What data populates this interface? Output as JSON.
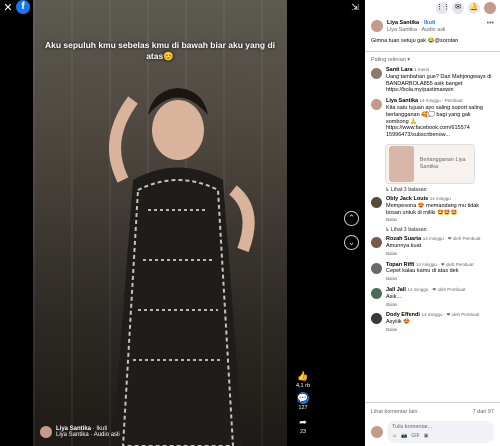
{
  "viewer": {
    "caption": "Aku sepuluh kmu sebelas kmu di bawah biar aku yang di atas😊",
    "overlay_name": "Liya Santika",
    "overlay_follow": "Ikuti",
    "overlay_audio": "Liya Santika · Audio asli",
    "watermark": "Liya Santika",
    "like_count": "4,1 rb",
    "comment_count": "127",
    "share_count": "23"
  },
  "panel": {
    "author": "Liya Santika",
    "follow": "Ikuti",
    "audio": "Liya Santika · Audio asli",
    "post_text": "Gimna tuan setuju gak 😂@sorotan",
    "relevance": "Paling relevan ▾",
    "comments": [
      {
        "name": "Santi Lara",
        "meta": "1 menit",
        "text": "Uang tambahan gue? Dari Mahjongways di BANDARBOLA855 asik banget https://bola.my/pastimaxwin",
        "color": "#8c7a6b"
      },
      {
        "name": "Liya Santika",
        "meta": "14 minggu · Pembuat",
        "text": "Kita satu tujuan ayo saling suport saling berlangganan 🥰💭 bagi yang gak sombong 🙏 https://www.facebook.com/615574 15996473/subscribenow...",
        "color": "#c49a8a"
      }
    ],
    "ad_text": "Berlangganan Liya Santika",
    "replies_1": "↳ Lihat 3 balasan",
    "comments2": [
      {
        "name": "Obly Jack Louis",
        "meta": "14 minggu",
        "text": "Mempesona 😍 memandang mu tidak bosan untuk di miliki 🤩🤩🤩",
        "action": "Balas",
        "color": "#5a4a3a"
      }
    ],
    "replies_2": "↳ Lihat 3 balasan",
    "comments3": [
      {
        "name": "Rozah Suarta",
        "meta": "14 minggu · ❤ oleh Pembuat",
        "text": "Amunnya kuat",
        "action": "Balas",
        "color": "#7a5a4a"
      },
      {
        "name": "Topan Riffi",
        "meta": "14 minggu · ❤ oleh Pembuat",
        "text": "Cepet kalau kamu di atas dek",
        "action": "Balas",
        "color": "#6a6a6a"
      },
      {
        "name": "Jall Jall",
        "meta": "14 minggu · ❤ oleh Pembuat",
        "text": "Asik...",
        "action": "Balas",
        "color": "#4a6a5a"
      },
      {
        "name": "Dody Effendi",
        "meta": "14 minggu · ❤ oleh Pembuat",
        "text": "Asyiiik 😍",
        "action": "Balas",
        "color": "#3a3a3a"
      }
    ],
    "more_comments": "Lihat komentar lain",
    "page_count": "7 dari 97",
    "input_placeholder": "Tulis komentar..."
  }
}
